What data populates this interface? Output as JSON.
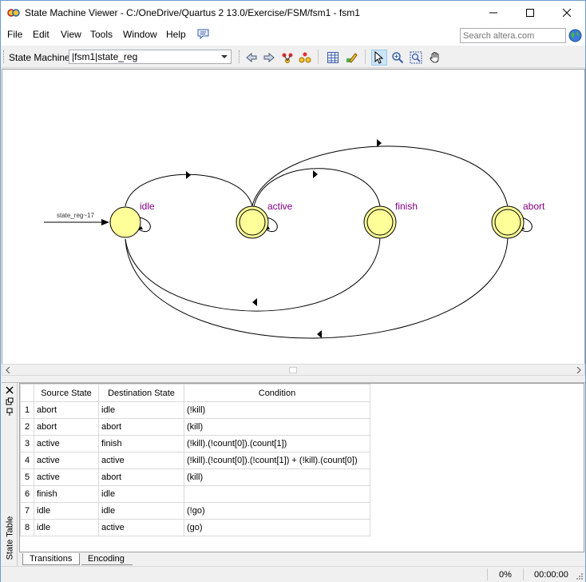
{
  "window": {
    "title": "State Machine Viewer - C:/OneDrive/Quartus 2 13.0/Exercise/FSM/fsm1 - fsm1"
  },
  "menu": {
    "items": [
      "File",
      "Edit",
      "View",
      "Tools",
      "Window",
      "Help"
    ],
    "search_placeholder": "Search altera.com"
  },
  "toolbar": {
    "state_machine_label": "State Machine:",
    "state_machine_value": "|fsm1|state_reg"
  },
  "diagram": {
    "reset_label": "state_reg~17",
    "states": [
      "idle",
      "active",
      "finish",
      "abort"
    ]
  },
  "panel": {
    "title": "State Table",
    "columns": [
      "Source State",
      "Destination State",
      "Condition"
    ],
    "rows": [
      {
        "num": "1",
        "source": "abort",
        "dest": "idle",
        "cond": "(!kill)"
      },
      {
        "num": "2",
        "source": "abort",
        "dest": "abort",
        "cond": "(kill)"
      },
      {
        "num": "3",
        "source": "active",
        "dest": "finish",
        "cond": "(!kill).(!count[0]).(count[1])"
      },
      {
        "num": "4",
        "source": "active",
        "dest": "active",
        "cond": "(!kill).(!count[0]).(!count[1]) + (!kill).(count[0])"
      },
      {
        "num": "5",
        "source": "active",
        "dest": "abort",
        "cond": "(kill)"
      },
      {
        "num": "6",
        "source": "finish",
        "dest": "idle",
        "cond": ""
      },
      {
        "num": "7",
        "source": "idle",
        "dest": "idle",
        "cond": "(!go)"
      },
      {
        "num": "8",
        "source": "idle",
        "dest": "active",
        "cond": "(go)"
      }
    ],
    "tabs": [
      "Transitions",
      "Encoding"
    ]
  },
  "status": {
    "progress": "0%",
    "time": "00:00:00"
  },
  "colors": {
    "state_fill": "#ffff99",
    "state_label": "#800080",
    "accent": "#0078d7"
  }
}
